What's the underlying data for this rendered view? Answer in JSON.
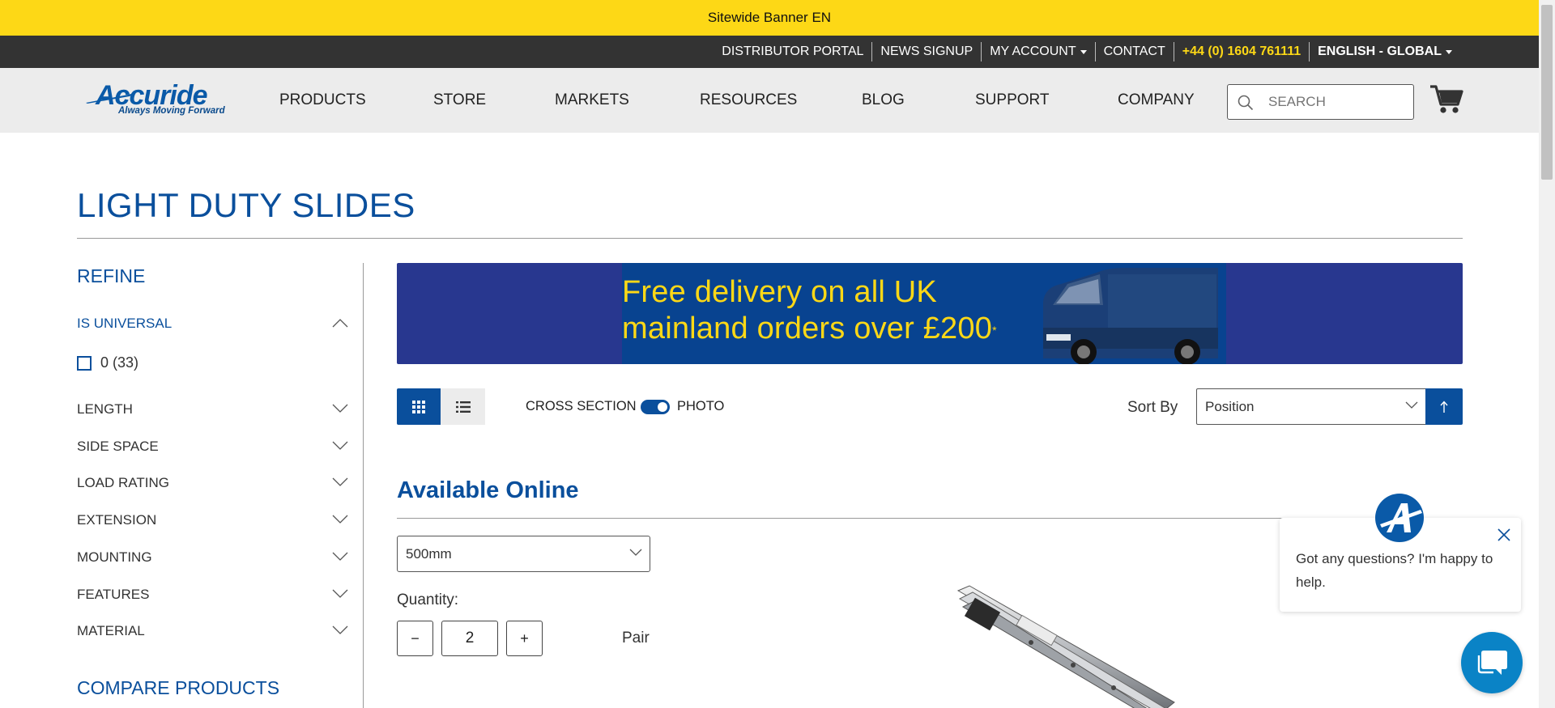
{
  "banner": {
    "text": "Sitewide Banner EN"
  },
  "utility_nav": {
    "distributor": "DISTRIBUTOR PORTAL",
    "news": "NEWS SIGNUP",
    "account": "MY ACCOUNT",
    "contact": "CONTACT",
    "phone": "+44 (0) 1604 761111",
    "language": "ENGLISH - GLOBAL"
  },
  "logo": {
    "name": "Accuride",
    "tagline": "Always Moving Forward"
  },
  "main_nav": [
    "PRODUCTS",
    "STORE",
    "MARKETS",
    "RESOURCES",
    "BLOG",
    "SUPPORT",
    "COMPANY"
  ],
  "search": {
    "placeholder": "SEARCH"
  },
  "page": {
    "title": "LIGHT DUTY SLIDES"
  },
  "sidebar": {
    "refine": "REFINE",
    "active_filter": {
      "label": "IS UNIVERSAL",
      "option": "0 (33)"
    },
    "filters": [
      "LENGTH",
      "SIDE SPACE",
      "LOAD RATING",
      "EXTENSION",
      "MOUNTING",
      "FEATURES",
      "MATERIAL"
    ],
    "compare": "COMPARE PRODUCTS"
  },
  "promo": {
    "line1": "Free delivery on all UK",
    "line2": "mainland orders over £200",
    "mark": "*"
  },
  "toolbar": {
    "cross_section": "CROSS SECTION",
    "photo": "PHOTO",
    "sort_label": "Sort By",
    "sort_value": "Position"
  },
  "available": {
    "title": "Available Online",
    "size_value": "500mm",
    "quantity_label": "Quantity:",
    "minus": "−",
    "plus": "+",
    "quantity_value": "2",
    "unit": "Pair"
  },
  "chat": {
    "message": "Got any questions? I'm happy to help."
  },
  "colors": {
    "brand_blue": "#0a4f9c",
    "banner_yellow": "#fdd816",
    "utility_bar": "#333333",
    "header_bg": "#ececec"
  }
}
